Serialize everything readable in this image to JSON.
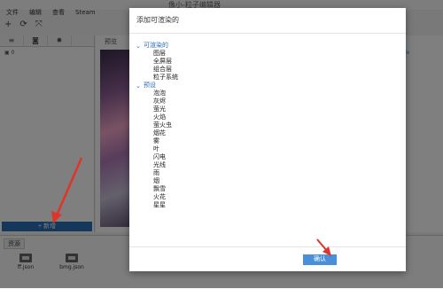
{
  "window": {
    "title": "像小-粒子编辑器"
  },
  "menu": [
    "文件",
    "编辑",
    "查看",
    "Steam"
  ],
  "toolbar": {
    "icons": [
      "add-icon",
      "refresh-icon",
      "expand-icon"
    ]
  },
  "left_panel": {
    "tabs": [
      "layers-icon",
      "camera-icon",
      "gear-icon"
    ],
    "layer_count": "0",
    "add_button": "+ 新增"
  },
  "preview": {
    "label": "预览",
    "right_link": "de"
  },
  "resources": {
    "tab": "资源",
    "files": [
      "ff.json",
      "bmg.json"
    ]
  },
  "modal": {
    "title": "添加可渲染的",
    "groups": [
      {
        "label": "可渲染的",
        "items": [
          "图层",
          "全屏层",
          "组合层",
          "粒子系统"
        ]
      },
      {
        "label": "预设",
        "items": [
          "泡泡",
          "灰烬",
          "萤光",
          "火焰",
          "萤火虫",
          "烟花",
          "雾",
          "叶",
          "闪电",
          "光线",
          "雨",
          "烟",
          "飘雪",
          "火花",
          "星星"
        ]
      }
    ],
    "confirm_button": "确认"
  },
  "colors": {
    "accent": "#2a6fb5",
    "confirm": "#4a90d9",
    "arrow": "#e0342a"
  }
}
